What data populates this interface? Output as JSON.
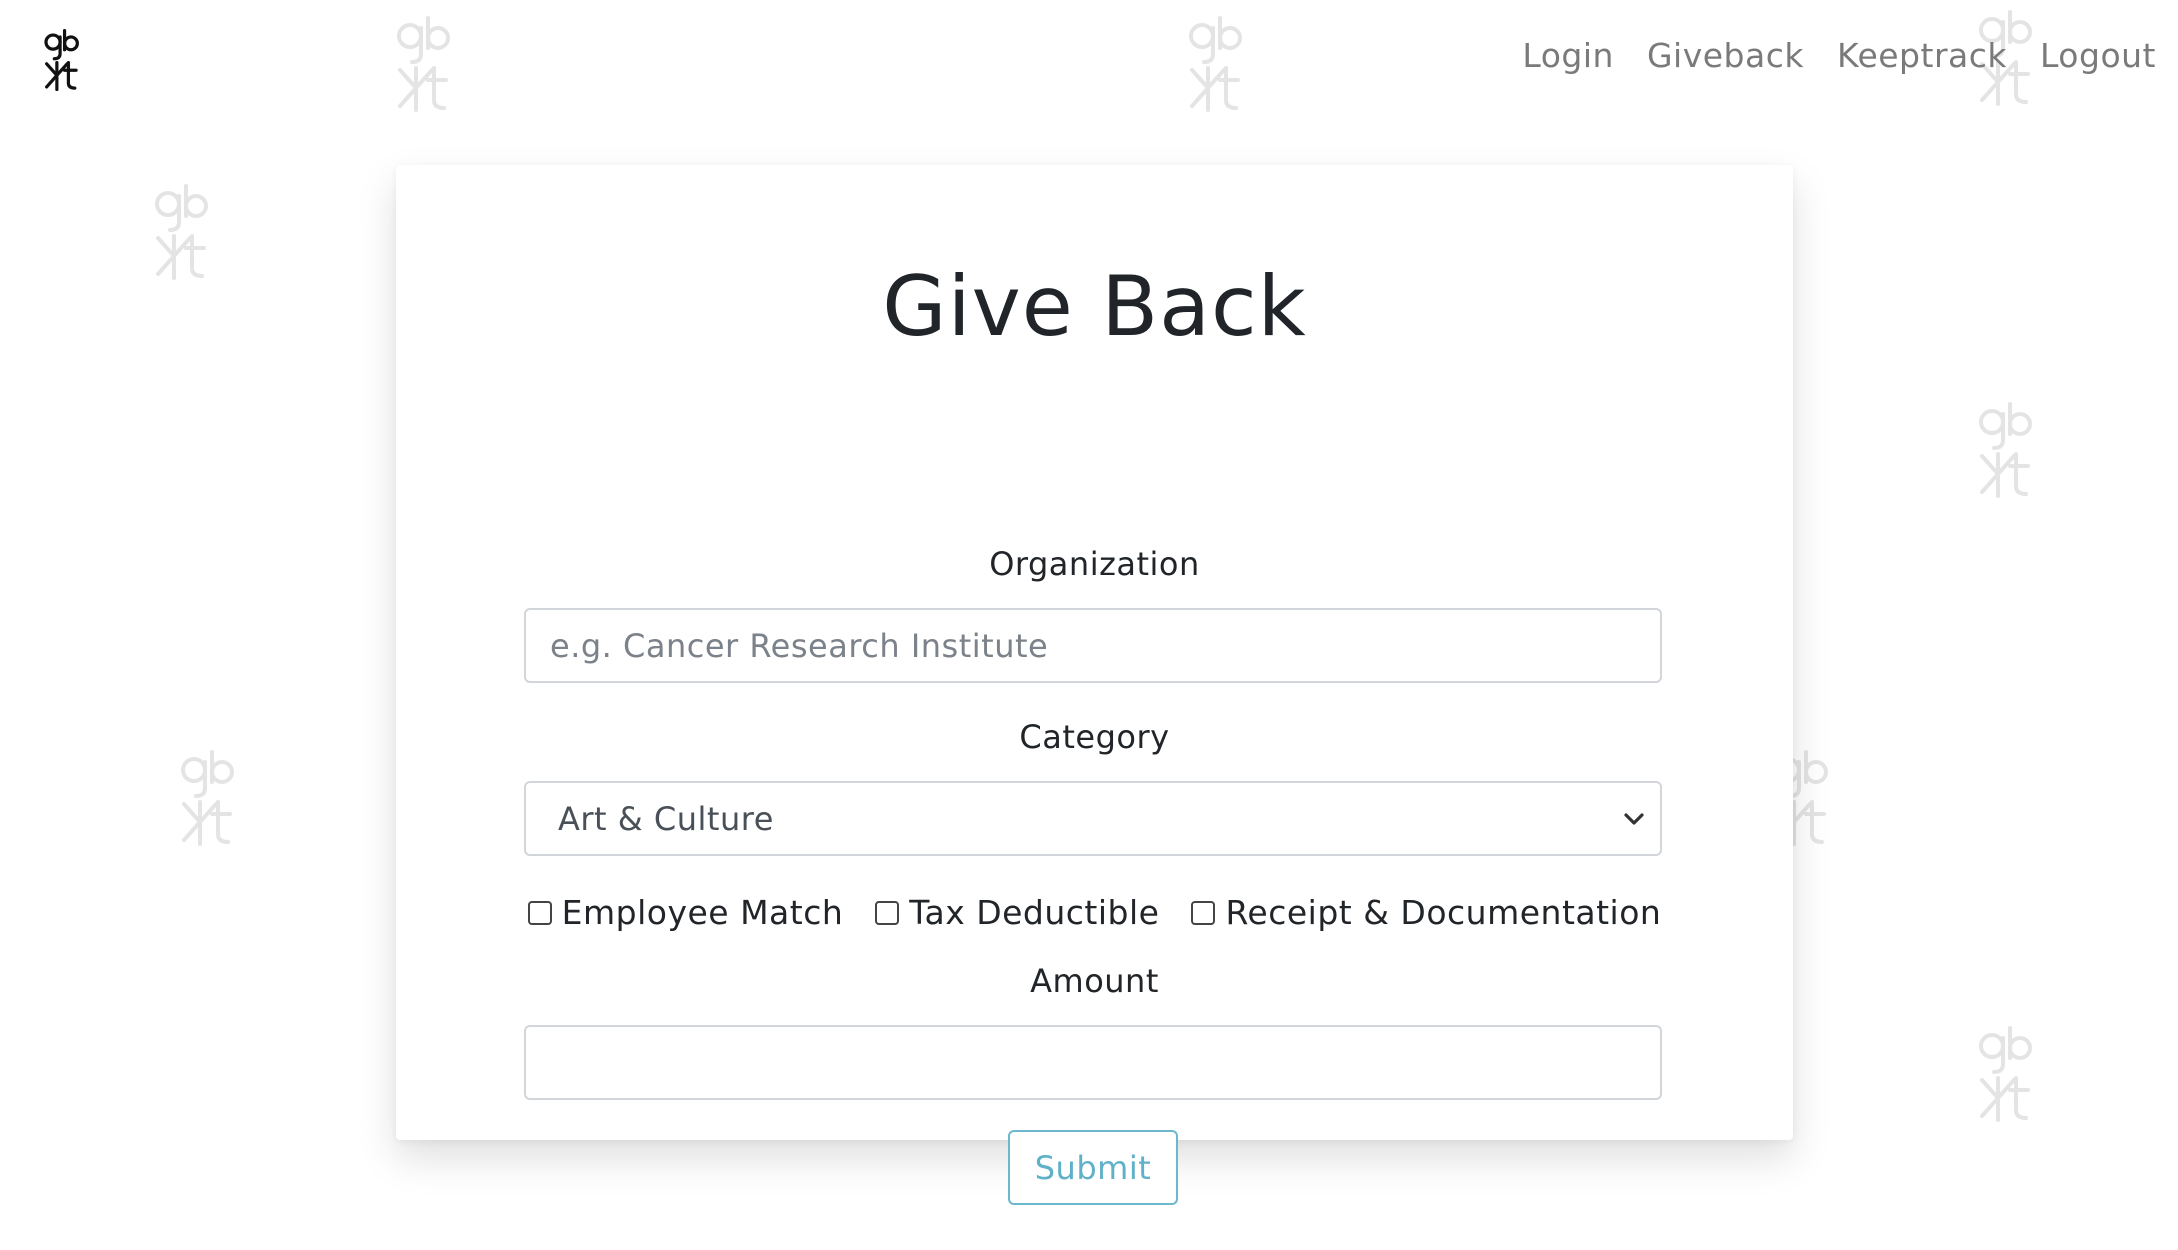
{
  "nav": {
    "login": "Login",
    "giveback": "Giveback",
    "keeptrack": "Keeptrack",
    "logout": "Logout"
  },
  "form": {
    "title": "Give Back",
    "organization_label": "Organization",
    "organization_placeholder": "e.g. Cancer Research Institute",
    "organization_value": "",
    "category_label": "Category",
    "category_selected": "Art & Culture",
    "checkboxes": [
      {
        "label": "Employee Match",
        "checked": false
      },
      {
        "label": "Tax Deductible",
        "checked": false
      },
      {
        "label": "Receipt & Documentation",
        "checked": false
      }
    ],
    "amount_label": "Amount",
    "amount_value": "",
    "submit_label": "Submit"
  },
  "colors": {
    "accent": "#5fb1c9",
    "nav_text": "#7a7a7a",
    "text": "#212529"
  },
  "icons": {
    "logo": "gbkt-logo-icon",
    "select": "chevron-down-icon"
  }
}
